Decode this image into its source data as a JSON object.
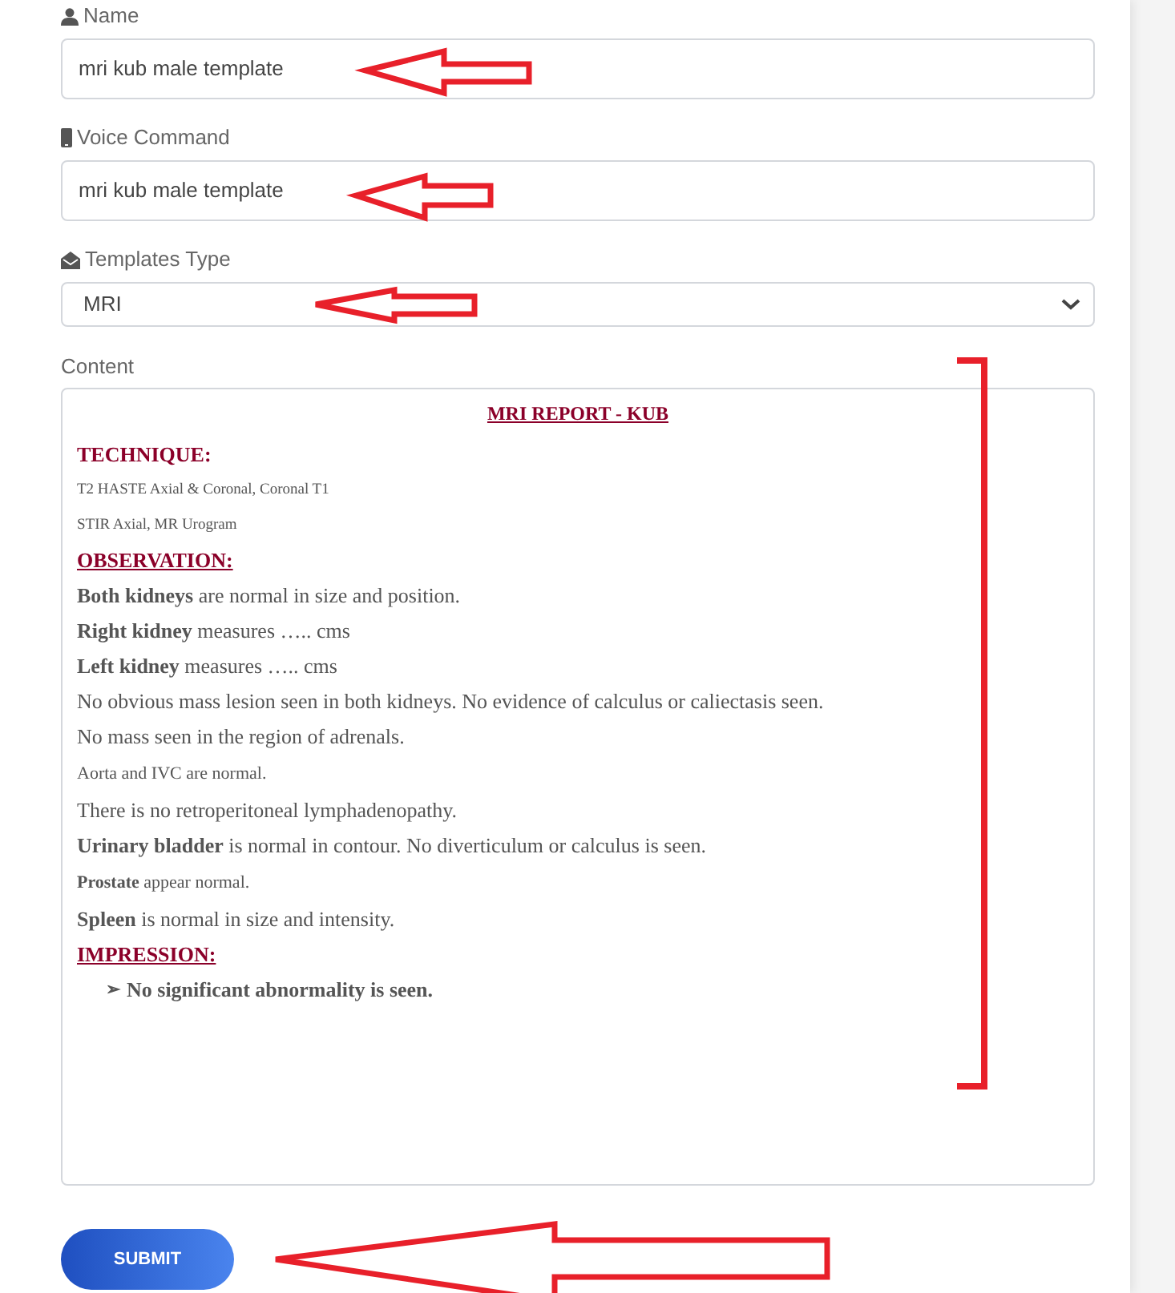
{
  "fields": [
    {
      "kind": "text",
      "label": "Name",
      "value": "mri kub male template"
    },
    {
      "kind": "text",
      "label": "Voice Command",
      "value": "mri kub male template"
    },
    {
      "kind": "select",
      "label": "Templates Type",
      "value": "MRI"
    }
  ],
  "content": {
    "label": "Content",
    "blocks": [
      {
        "kind": "title",
        "text": "MRI REPORT - KUB"
      },
      {
        "kind": "heading",
        "text": "TECHNIQUE:",
        "underline": false
      },
      {
        "kind": "small",
        "text": "T2 HASTE Axial & Coronal, Coronal T1"
      },
      {
        "kind": "small",
        "text": "STIR Axial, MR Urogram"
      },
      {
        "kind": "heading",
        "text": "OBSERVATION:",
        "underline": true
      },
      {
        "kind": "para",
        "text": "**Both kidneys** are normal in size and position."
      },
      {
        "kind": "para",
        "text": "**Right kidney** measures ….. cms"
      },
      {
        "kind": "para",
        "text": "**Left kidney** measures ….. cms"
      },
      {
        "kind": "para",
        "text": "No obvious mass lesion seen in both kidneys. No evidence of calculus or caliectasis seen."
      },
      {
        "kind": "para",
        "text": "No mass seen in the region of adrenals."
      },
      {
        "kind": "medium",
        "text": "Aorta and IVC are normal."
      },
      {
        "kind": "para",
        "text": "There is no retroperitoneal lymphadenopathy."
      },
      {
        "kind": "para",
        "text": "**Urinary bladder** is normal in contour. No diverticulum or calculus is seen."
      },
      {
        "kind": "medium",
        "text": "**Prostate** appear normal."
      },
      {
        "kind": "para",
        "text": "**Spleen** is normal in size and intensity."
      },
      {
        "kind": "heading",
        "text": "IMPRESSION:",
        "underline": true
      },
      {
        "kind": "bullet",
        "marker": "➢",
        "text": "No significant abnormality is seen."
      }
    ]
  },
  "submit": "SUBMIT"
}
